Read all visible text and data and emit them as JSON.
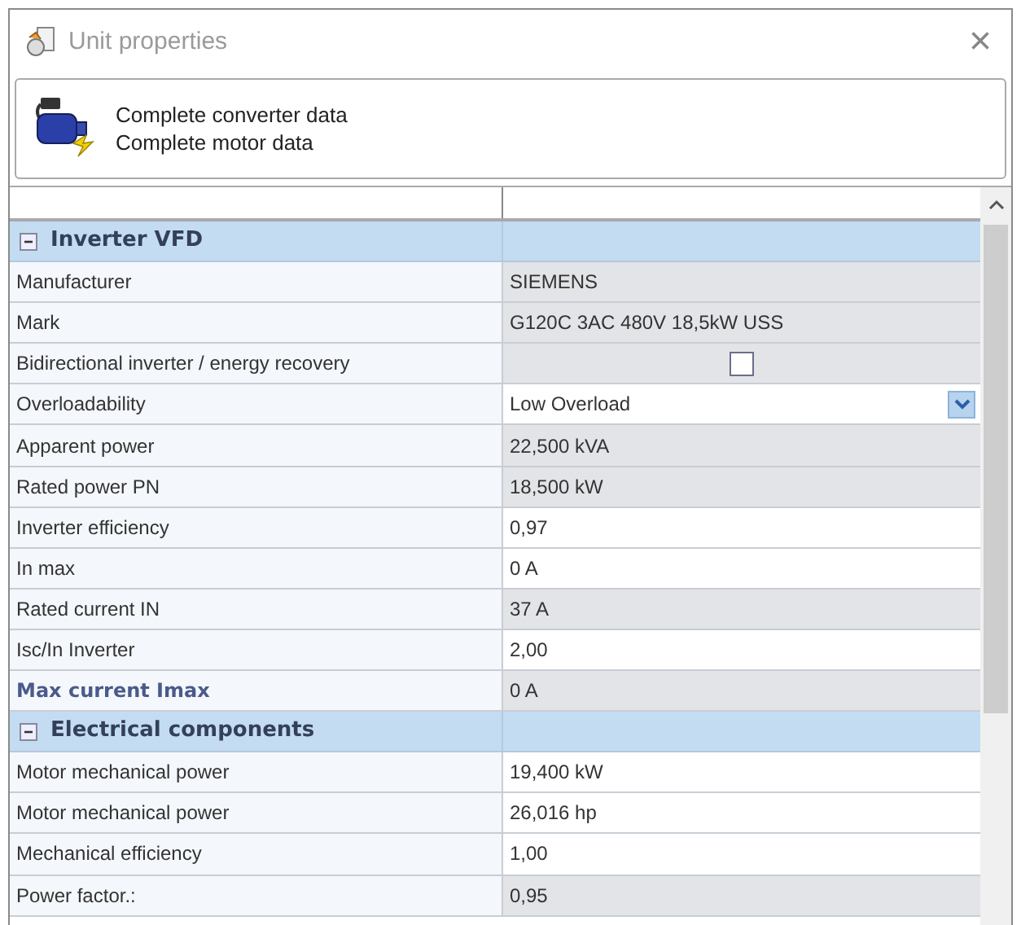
{
  "window": {
    "title": "Unit properties",
    "close": "×"
  },
  "header": {
    "lines": [
      "Complete converter data",
      "Complete motor data"
    ]
  },
  "sections": [
    {
      "title": "Inverter VFD",
      "expanded": true,
      "rows": [
        {
          "label": "Manufacturer",
          "kind": "text",
          "value": "SIEMENS",
          "readonly": true,
          "emphasized": false
        },
        {
          "label": "Mark",
          "kind": "text",
          "value": "G120C 3AC 480V 18,5kW USS",
          "readonly": true,
          "emphasized": false
        },
        {
          "label": "Bidirectional inverter / energy recovery",
          "kind": "checkbox",
          "checked": false,
          "readonly": true,
          "emphasized": false
        },
        {
          "label": "Overloadability",
          "kind": "dropdown",
          "value": "Low Overload",
          "readonly": false,
          "emphasized": false
        },
        {
          "label": "Apparent power",
          "kind": "text",
          "value": "22,500 kVA",
          "readonly": true,
          "emphasized": false
        },
        {
          "label": "Rated power PN",
          "kind": "text",
          "value": "18,500 kW",
          "readonly": true,
          "emphasized": false
        },
        {
          "label": "Inverter efficiency",
          "kind": "text",
          "value": "0,97",
          "readonly": false,
          "emphasized": false
        },
        {
          "label": "In max",
          "kind": "text",
          "value": "0 A",
          "readonly": false,
          "emphasized": false
        },
        {
          "label": "Rated current IN",
          "kind": "text",
          "value": "37 A",
          "readonly": true,
          "emphasized": false
        },
        {
          "label": "Isc/In Inverter",
          "kind": "text",
          "value": "2,00",
          "readonly": false,
          "emphasized": false
        },
        {
          "label": "Max current Imax",
          "kind": "text",
          "value": "0 A",
          "readonly": true,
          "emphasized": true
        }
      ]
    },
    {
      "title": "Electrical components",
      "expanded": true,
      "rows": [
        {
          "label": "Motor mechanical power",
          "kind": "text",
          "value": "19,400 kW",
          "readonly": false,
          "emphasized": false
        },
        {
          "label": "Motor mechanical power",
          "kind": "text",
          "value": "26,016 hp",
          "readonly": false,
          "emphasized": false
        },
        {
          "label": "Mechanical efficiency",
          "kind": "text",
          "value": "1,00",
          "readonly": false,
          "emphasized": false
        },
        {
          "label": "Power factor.:",
          "kind": "text",
          "value": "0,95",
          "readonly": true,
          "emphasized": false
        }
      ]
    }
  ]
}
